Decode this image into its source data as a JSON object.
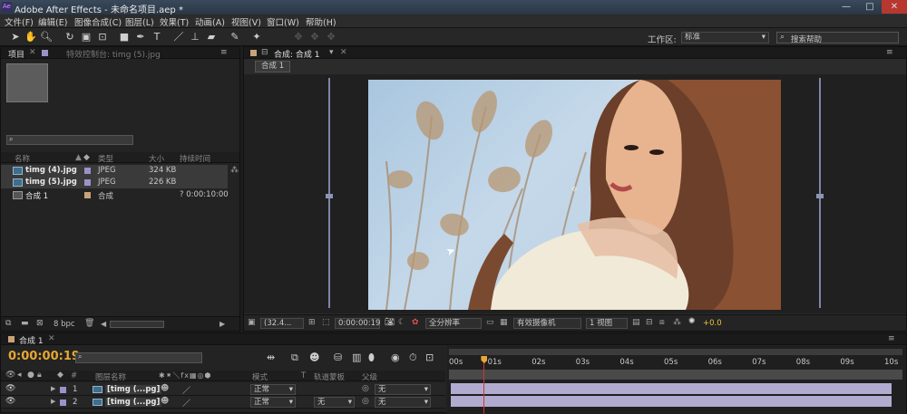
{
  "titlebar": {
    "title": "Adobe After Effects - 未命名项目.aep *"
  },
  "menu": [
    "文件(F)",
    "编辑(E)",
    "图像合成(C)",
    "图层(L)",
    "效果(T)",
    "动画(A)",
    "视图(V)",
    "窗口(W)",
    "帮助(H)"
  ],
  "toolbar": {
    "workspace_label": "工作区:",
    "workspace_value": "标准",
    "search_placeholder": "搜索帮助"
  },
  "project_panel": {
    "tab_project": "项目",
    "tab_effects": "特效控制台: timg (5).jpg",
    "columns": [
      "名称",
      "类型",
      "大小",
      "持续时间"
    ],
    "items": [
      {
        "name": "timg (4).jpg",
        "type": "JPEG",
        "size": "324 KB",
        "duration": ""
      },
      {
        "name": "timg (5).jpg",
        "type": "JPEG",
        "size": "226 KB",
        "duration": ""
      },
      {
        "name": "合成 1",
        "type": "合成",
        "size": "",
        "duration": "? 0:00:10:00"
      }
    ],
    "bpc": "8 bpc"
  },
  "comp_viewer": {
    "tab": "合成: 合成 1",
    "subtab": "合成 1",
    "zoom": "(32.4...",
    "timecode": "0:00:00:19",
    "resolution": "全分辨率",
    "camera": "有效摄像机",
    "views": "1 视图",
    "exposure": "+0.0"
  },
  "timeline": {
    "tab": "合成 1",
    "timecode": "0:00:00:19",
    "col_layer_name": "图层名称",
    "col_mode": "模式",
    "col_trkmat": "轨道蒙板",
    "col_parent": "父级",
    "col_t": "T",
    "ruler": [
      "00s",
      "01s",
      "02s",
      "03s",
      "04s",
      "05s",
      "06s",
      "07s",
      "08s",
      "09s",
      "10s"
    ],
    "playhead_fraction": 0.079,
    "layers": [
      {
        "num": "1",
        "name": "[timg (...pg]",
        "mode": "正常",
        "trkmat": "",
        "parent": "无"
      },
      {
        "num": "2",
        "name": "[timg (...pg]",
        "mode": "正常",
        "trkmat": "无",
        "parent": "无"
      }
    ]
  },
  "colors": {
    "label_purple": "#9b92c9",
    "timecode_orange": "#e8a732",
    "playhead": "#e8a732",
    "current_time_line": "#d9322e"
  }
}
